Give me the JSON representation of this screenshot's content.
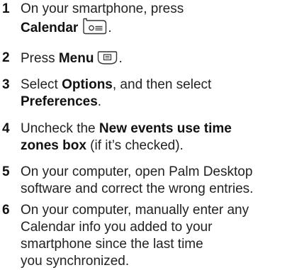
{
  "steps": [
    {
      "number": "1",
      "line1": "On your smartphone, press",
      "bold": "Calendar",
      "end": ".",
      "icon": "calendar-button-icon"
    },
    {
      "number": "2",
      "pre": "Press ",
      "bold": "Menu",
      "end": ".",
      "icon": "menu-button-icon"
    },
    {
      "number": "3",
      "pre": "Select ",
      "bold1": "Options",
      "mid": ", and then select",
      "bold2": "Preferences",
      "end": "."
    },
    {
      "number": "4",
      "pre": "Uncheck the ",
      "bold_line1": "New events use time",
      "bold_line2": "zones box",
      "post": " (if it’s checked)."
    },
    {
      "number": "5",
      "lines": [
        "On your computer, open Palm Desktop",
        "software and correct the wrong entries."
      ]
    },
    {
      "number": "6",
      "lines": [
        "On your computer, manually enter any",
        "Calendar info you added to your",
        "smartphone since the last time",
        "you synchronized."
      ]
    }
  ],
  "colors": {
    "text": "#222222",
    "icon_stroke": "#333333"
  }
}
